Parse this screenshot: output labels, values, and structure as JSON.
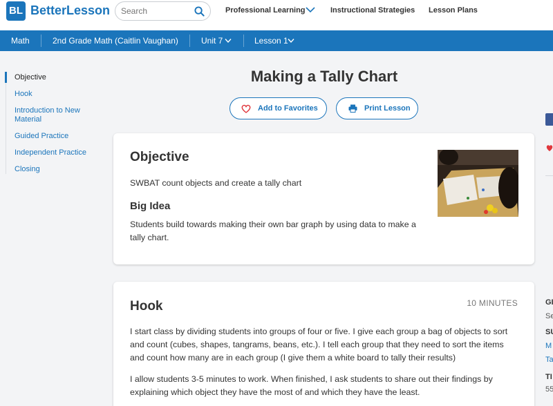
{
  "header": {
    "logo_mark": "BL",
    "logo_text": "BetterLesson",
    "search_placeholder": "Search",
    "nav": [
      "Professional Learning",
      "Instructional Strategies",
      "Lesson Plans"
    ]
  },
  "course_bar": {
    "items": [
      "Math",
      "2nd Grade Math (Caitlin Vaughan)",
      "Unit 7",
      "Lesson 1"
    ]
  },
  "sidebar": {
    "items": [
      "Objective",
      "Hook",
      "Introduction to New Material",
      "Guided Practice",
      "Independent Practice",
      "Closing"
    ],
    "active": "Objective"
  },
  "lesson": {
    "title": "Making a Tally Chart",
    "favorites_label": "Add to Favorites",
    "print_label": "Print Lesson"
  },
  "objective": {
    "heading": "Objective",
    "text": "SWBAT count objects and create a tally chart",
    "big_idea_heading": "Big Idea",
    "big_idea_text": "Students build towards making their own bar graph by using data to make a tally chart."
  },
  "hook": {
    "heading": "Hook",
    "minutes": "10 MINUTES",
    "paragraphs": [
      "I start class by dividing students into groups of four or five.  I give each group a bag of objects to sort and count (cubes, shapes, tangrams, beans, etc.).  I tell each group that they need to sort the items and count how many are in each group (I give them a white board to tally their results)",
      "I allow students 3-5 minutes to work.  When finished, I ask students to share out their findings by explaining which object they have the most of and which they have the least."
    ]
  },
  "right_edge": [
    "GI",
    "Se",
    "SU",
    "M",
    "Ta",
    "TI",
    "55"
  ],
  "colors": {
    "brand": "#1b75bb",
    "favorite_heart": "#e0363c"
  }
}
